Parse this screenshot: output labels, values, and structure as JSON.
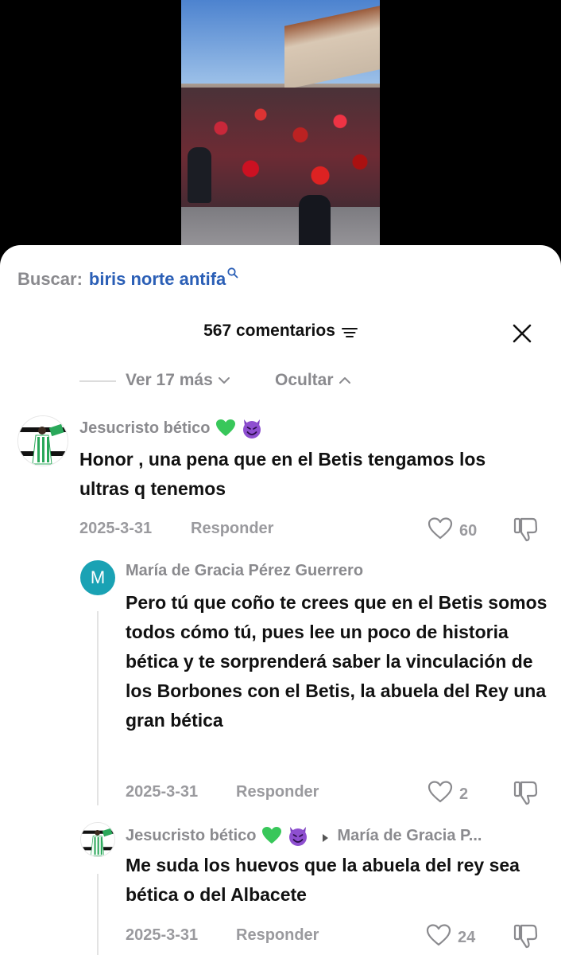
{
  "search": {
    "prefix": "Buscar:",
    "query": "biris norte antifa"
  },
  "header": {
    "count_label": "567 comentarios"
  },
  "toggles": {
    "more_label": "Ver 17 más",
    "hide_label": "Ocultar"
  },
  "comments": [
    {
      "username": "Jesucristo bético",
      "text": "Honor , una pena que en el Betis tengamos los ultras q tenemos",
      "date": "2025-3-31",
      "reply_label": "Responder",
      "likes": "60"
    },
    {
      "avatar_letter": "M",
      "username": "María de Gracia Pérez Guerrero",
      "text": "Pero tú que coño te crees que en el Betis somos todos cómo tú, pues lee un poco de historia bética y te sorprenderá saber la vinculación de los Borbones con el Betis, la abuela del Rey una gran bética",
      "date": "2025-3-31",
      "reply_label": "Responder",
      "likes": "2"
    },
    {
      "username": "Jesucristo bético",
      "reply_to": "María de Gracia P...",
      "text": "Me suda los huevos que la abuela del rey sea bética o del Albacete",
      "date": "2025-3-31",
      "reply_label": "Responder",
      "likes": "24"
    }
  ],
  "colors": {
    "link_blue": "#2b5fb6",
    "muted": "#8a8a8e",
    "avatar_teal": "#1aa2b4",
    "heart_green": "#38c75a",
    "devil_purple": "#7b3fbf"
  }
}
